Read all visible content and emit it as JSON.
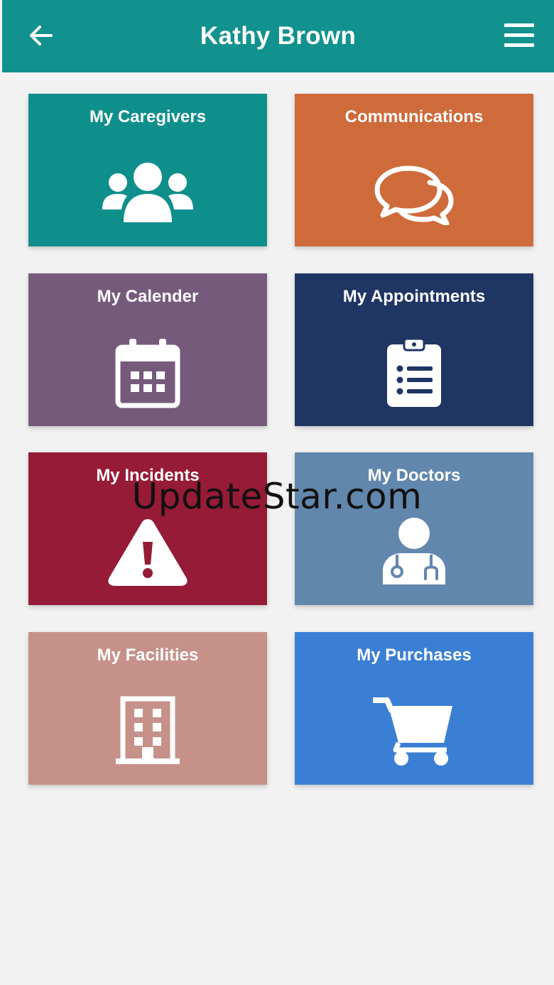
{
  "header": {
    "title": "Kathy Brown",
    "bg_color": "#12928f",
    "back_icon": "arrow-left-icon",
    "menu_icon": "hamburger-menu-icon"
  },
  "tiles": [
    {
      "label": "My Caregivers",
      "color": "#0f8f8c",
      "icon": "users-group-icon"
    },
    {
      "label": "Communications",
      "color": "#cf6a3a",
      "icon": "chat-bubbles-icon"
    },
    {
      "label": "My Calender",
      "color": "#765a7c",
      "icon": "calendar-icon"
    },
    {
      "label": "My Appointments",
      "color": "#1f3563",
      "icon": "clipboard-list-icon"
    },
    {
      "label": "My Incidents",
      "color": "#961b36",
      "icon": "warning-triangle-icon"
    },
    {
      "label": "My Doctors",
      "color": "#6287ac",
      "icon": "doctor-icon"
    },
    {
      "label": "My Facilities",
      "color": "#c59189",
      "icon": "building-icon"
    },
    {
      "label": "My Purchases",
      "color": "#3a7fd4",
      "icon": "shopping-cart-icon"
    }
  ],
  "watermark": "UpdateStar.com"
}
